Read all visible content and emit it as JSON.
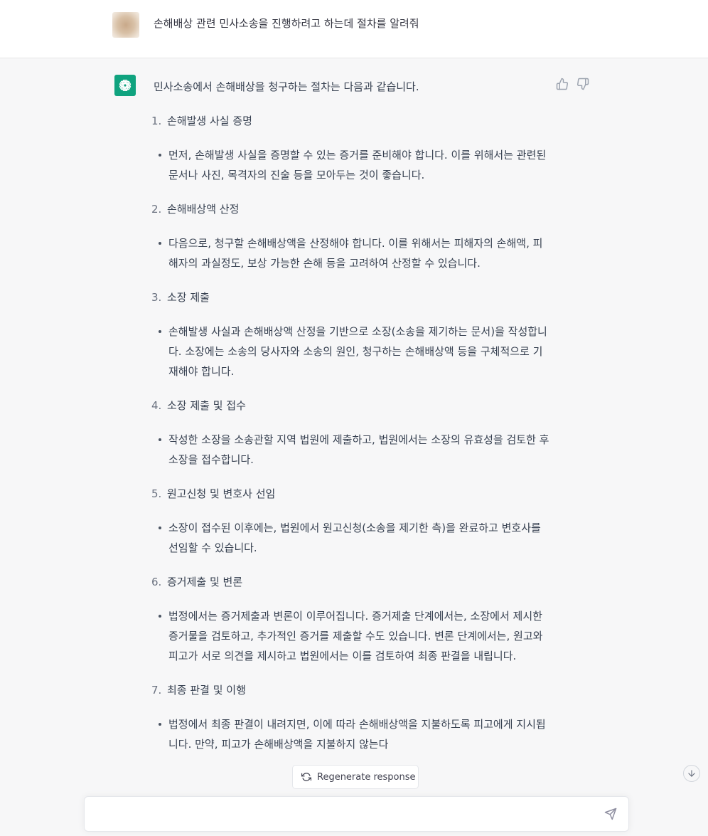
{
  "user_message": "손해배상 관련 민사소송을 진행하려고 하는데 절차를 알려줘",
  "assistant": {
    "intro": "민사소송에서 손해배상을 청구하는 절차는 다음과 같습니다.",
    "steps": [
      {
        "num": "1.",
        "title": "손해발생 사실 증명",
        "detail": "먼저, 손해발생 사실을 증명할 수 있는 증거를 준비해야 합니다. 이를 위해서는 관련된 문서나 사진, 목격자의 진술 등을 모아두는 것이 좋습니다."
      },
      {
        "num": "2.",
        "title": "손해배상액 산정",
        "detail": "다음으로, 청구할 손해배상액을 산정해야 합니다. 이를 위해서는 피해자의 손해액, 피해자의 과실정도, 보상 가능한 손해 등을 고려하여 산정할 수 있습니다."
      },
      {
        "num": "3.",
        "title": "소장 제출",
        "detail": "손해발생 사실과 손해배상액 산정을 기반으로 소장(소송을 제기하는 문서)을 작성합니다. 소장에는 소송의 당사자와 소송의 원인, 청구하는 손해배상액 등을 구체적으로 기재해야 합니다."
      },
      {
        "num": "4.",
        "title": "소장 제출 및 접수",
        "detail": "작성한 소장을 소송관할 지역 법원에 제출하고, 법원에서는 소장의 유효성을 검토한 후 소장을 접수합니다."
      },
      {
        "num": "5.",
        "title": "원고신청 및 변호사 선임",
        "detail": "소장이 접수된 이후에는, 법원에서 원고신청(소송을 제기한 측)을 완료하고 변호사를 선임할 수 있습니다."
      },
      {
        "num": "6.",
        "title": "증거제출 및 변론",
        "detail": "법정에서는 증거제출과 변론이 이루어집니다. 증거제출 단계에서는, 소장에서 제시한 증거물을 검토하고, 추가적인 증거를 제출할 수도 있습니다. 변론 단계에서는, 원고와 피고가 서로 의견을 제시하고 법원에서는 이를 검토하여 최종 판결을 내립니다."
      },
      {
        "num": "7.",
        "title": "최종 판결 및 이행",
        "detail": "법정에서 최종 판결이 내려지면, 이에 따라 손해배상액을 지불하도록 피고에게 지시됩니다. 만약, 피고가 손해배상액을 지불하지 않는다"
      }
    ]
  },
  "regenerate_label": "Regenerate response",
  "input": {
    "placeholder": ""
  },
  "icons": {
    "user_avatar": "blurred-avatar",
    "assistant_avatar": "openai-logo-icon",
    "thumb_up": "thumbs-up-icon",
    "thumb_down": "thumbs-down-icon",
    "regenerate": "refresh-icon",
    "scroll_down": "arrow-down-icon",
    "send": "paper-plane-icon"
  },
  "colors": {
    "brand": "#10a37f",
    "background": "#f7f7f8",
    "text": "#374151"
  }
}
